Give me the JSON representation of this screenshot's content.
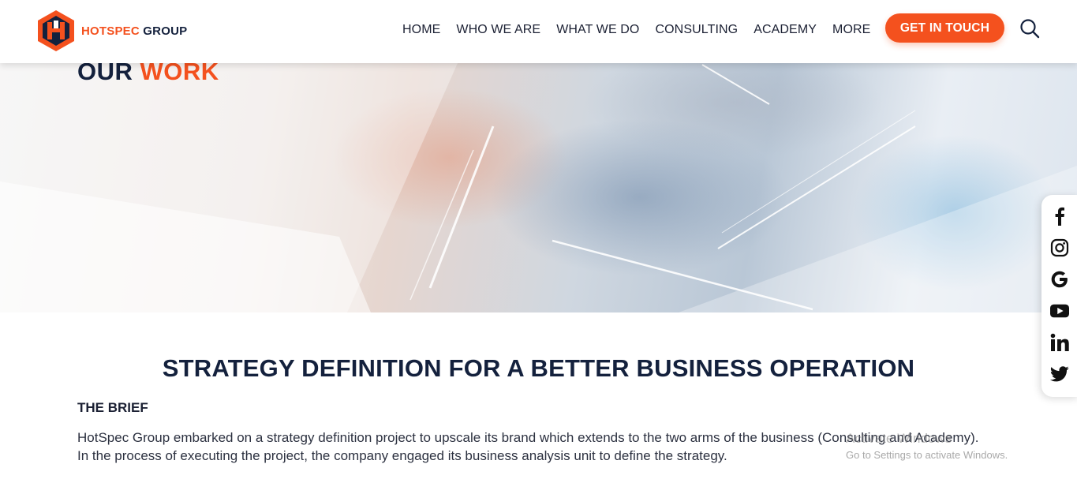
{
  "brand": {
    "logo_part1": "HOTSPEC",
    "logo_part2": "GROUP",
    "accent_color": "#f4511e",
    "navy_color": "#14213d"
  },
  "nav": {
    "items": [
      {
        "label": "HOME"
      },
      {
        "label": "WHO WE ARE"
      },
      {
        "label": "WHAT WE DO"
      },
      {
        "label": "CONSULTING"
      },
      {
        "label": "ACADEMY"
      },
      {
        "label": "MORE"
      }
    ],
    "cta_label": "GET IN TOUCH",
    "search_icon": "search-icon"
  },
  "hero": {
    "title_part1": "OUR",
    "title_part2": "WORK"
  },
  "social": {
    "icons": [
      "facebook-icon",
      "instagram-icon",
      "google-icon",
      "youtube-icon",
      "linkedin-icon",
      "twitter-icon"
    ]
  },
  "article": {
    "headline": "STRATEGY DEFINITION FOR A BETTER BUSINESS OPERATION",
    "brief_label": "THE BRIEF",
    "brief_text": "HotSpec Group embarked on a strategy definition project to upscale its brand which extends to the two arms of the business (Consulting and Academy). In the process of executing the project, the company engaged its business analysis unit to define the strategy."
  },
  "os_overlay": {
    "line1": "Activate Windows",
    "line2": "Go to Settings to activate Windows."
  }
}
